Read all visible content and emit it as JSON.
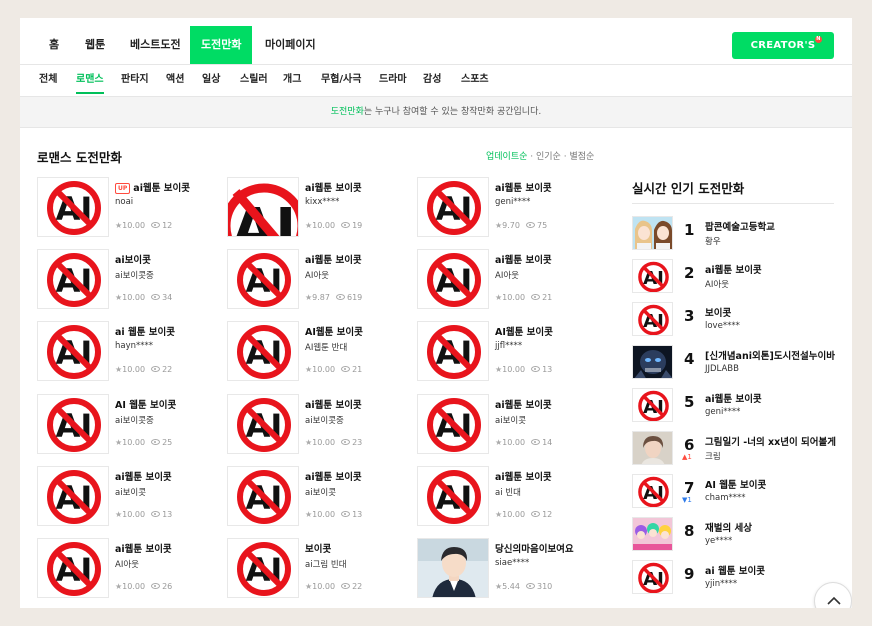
{
  "nav": {
    "items": [
      "홈",
      "웹툰",
      "베스트도전",
      "도전만화",
      "마이페이지"
    ],
    "creators_label": "CREATOR'S",
    "creators_badge": "N"
  },
  "genres": [
    "전체",
    "로맨스",
    "판타지",
    "액션",
    "일상",
    "스릴러",
    "개그",
    "무협/사극",
    "드라마",
    "감성",
    "스포츠"
  ],
  "banner": {
    "highlight": "도전만화",
    "text": "는 누구나 참여할 수 있는 창작만화 공간입니다."
  },
  "section": {
    "title": "로맨스 도전만화",
    "sort_active": "업데이트순",
    "sort_sep1": " · ",
    "sort_option2": "인기순",
    "sort_sep2": " · ",
    "sort_option3": "별점순"
  },
  "up_badge": "UP",
  "star_glyph": "★",
  "cards": [
    {
      "title": "ai웹툰 보이콧",
      "author": "noai",
      "rating": "10.00",
      "views": "12",
      "thumb": "ai-ban",
      "up": true
    },
    {
      "title": "ai웹툰 보이콧",
      "author": "kixx****",
      "rating": "10.00",
      "views": "19",
      "thumb": "ai-ban-large"
    },
    {
      "title": "ai웹툰 보이콧",
      "author": "geni****",
      "rating": "9.70",
      "views": "75",
      "thumb": "ai-ban"
    },
    {
      "title": "ai보이콧",
      "author": "ai보이콧중",
      "rating": "10.00",
      "views": "34",
      "thumb": "ai-ban"
    },
    {
      "title": "ai웹툰 보이콧",
      "author": "AI아웃",
      "rating": "9.87",
      "views": "619",
      "thumb": "ai-ban"
    },
    {
      "title": "ai웹툰 보이콧",
      "author": "AI아웃",
      "rating": "10.00",
      "views": "21",
      "thumb": "ai-ban"
    },
    {
      "title": "ai 웹툰 보이콧",
      "author": "hayn****",
      "rating": "10.00",
      "views": "22",
      "thumb": "ai-ban"
    },
    {
      "title": "AI웹툰 보이콧",
      "author": "AI웹툰 반대",
      "rating": "10.00",
      "views": "21",
      "thumb": "ai-ban"
    },
    {
      "title": "AI웹툰 보이콧",
      "author": "jjfl****",
      "rating": "10.00",
      "views": "13",
      "thumb": "ai-ban"
    },
    {
      "title": "AI 웹툰 보이콧",
      "author": "ai보이콧중",
      "rating": "10.00",
      "views": "25",
      "thumb": "ai-ban"
    },
    {
      "title": "ai웹툰 보이콧",
      "author": "ai보이콧중",
      "rating": "10.00",
      "views": "23",
      "thumb": "ai-ban"
    },
    {
      "title": "ai웹툰 보이콧",
      "author": "ai보이콧",
      "rating": "10.00",
      "views": "14",
      "thumb": "ai-ban"
    },
    {
      "title": "ai웹툰 보이콧",
      "author": "ai보이콧",
      "rating": "10.00",
      "views": "13",
      "thumb": "ai-ban"
    },
    {
      "title": "ai웹툰 보이콧",
      "author": "ai보이콧",
      "rating": "10.00",
      "views": "13",
      "thumb": "ai-ban"
    },
    {
      "title": "ai웹툰 보이콧",
      "author": "ai 빈대",
      "rating": "10.00",
      "views": "12",
      "thumb": "ai-ban"
    },
    {
      "title": "ai웹툰 보이콧",
      "author": "AI아웃",
      "rating": "10.00",
      "views": "26",
      "thumb": "ai-ban"
    },
    {
      "title": "보이콧",
      "author": "ai그림 빈대",
      "rating": "10.00",
      "views": "22",
      "thumb": "ai-ban"
    },
    {
      "title": "당신의마음이보여요",
      "author": "siae****",
      "rating": "5.44",
      "views": "310",
      "thumb": "character-boy"
    }
  ],
  "ranking": {
    "title": "실시간 인기 도전만화",
    "items": [
      {
        "rank": "1",
        "title": "팝콘예술고등학교",
        "author": "황우",
        "thumb": "character-girls"
      },
      {
        "rank": "2",
        "title": "ai웹툰 보이콧",
        "author": "AI아웃",
        "thumb": "ai-ban"
      },
      {
        "rank": "3",
        "title": "보이콧",
        "author": "love****",
        "thumb": "ai-ban"
      },
      {
        "rank": "4",
        "title": "[신개념ani외톤]도시전설누이바",
        "author": "JJDLABB",
        "thumb": "dark-robot"
      },
      {
        "rank": "5",
        "title": "ai웹툰 보이콧",
        "author": "geni****",
        "thumb": "ai-ban"
      },
      {
        "rank": "6",
        "title": "그림일기 -너의 xx년이 되어볼게",
        "author": "크림",
        "change": "▲1",
        "change_dir": "up",
        "thumb": "photo-girl"
      },
      {
        "rank": "7",
        "title": "AI 웹툰 보이콧",
        "author": "cham****",
        "change": "▼1",
        "change_dir": "down",
        "thumb": "ai-ban"
      },
      {
        "rank": "8",
        "title": "재벌의 세상",
        "author": "ye****",
        "thumb": "character-group"
      },
      {
        "rank": "9",
        "title": "ai 웹툰 보이콧",
        "author": "yjin****",
        "thumb": "ai-ban"
      }
    ]
  },
  "colors": {
    "brand": "#00dc64",
    "brand_text": "#00c05a",
    "ban_red": "#e8141c",
    "up": "#ff4b3e",
    "down": "#2f7bea"
  }
}
